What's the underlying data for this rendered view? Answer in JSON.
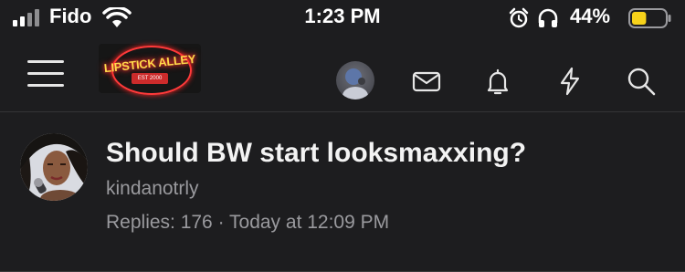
{
  "status_bar": {
    "carrier": "Fido",
    "time": "1:23 PM",
    "battery_percent": "44%",
    "battery_level": 0.44,
    "battery_color": "#f7d21a",
    "icons": [
      "signal-icon",
      "wifi-icon",
      "alarm-icon",
      "headphones-icon",
      "battery-icon"
    ]
  },
  "header": {
    "logo_text": "LIPSTICK ALLEY",
    "logo_est": "EST 2000",
    "icons": [
      "menu-icon",
      "mail-icon",
      "bell-icon",
      "bolt-icon",
      "search-icon"
    ]
  },
  "thread": {
    "title": "Should BW start looksmaxxing?",
    "author": "kindanotrly",
    "meta": "Replies: 176 · Today at 12:09 PM"
  },
  "colors": {
    "background": "#1d1d1f",
    "text_primary": "#f3f3f3",
    "text_secondary": "#9a9a9e"
  }
}
